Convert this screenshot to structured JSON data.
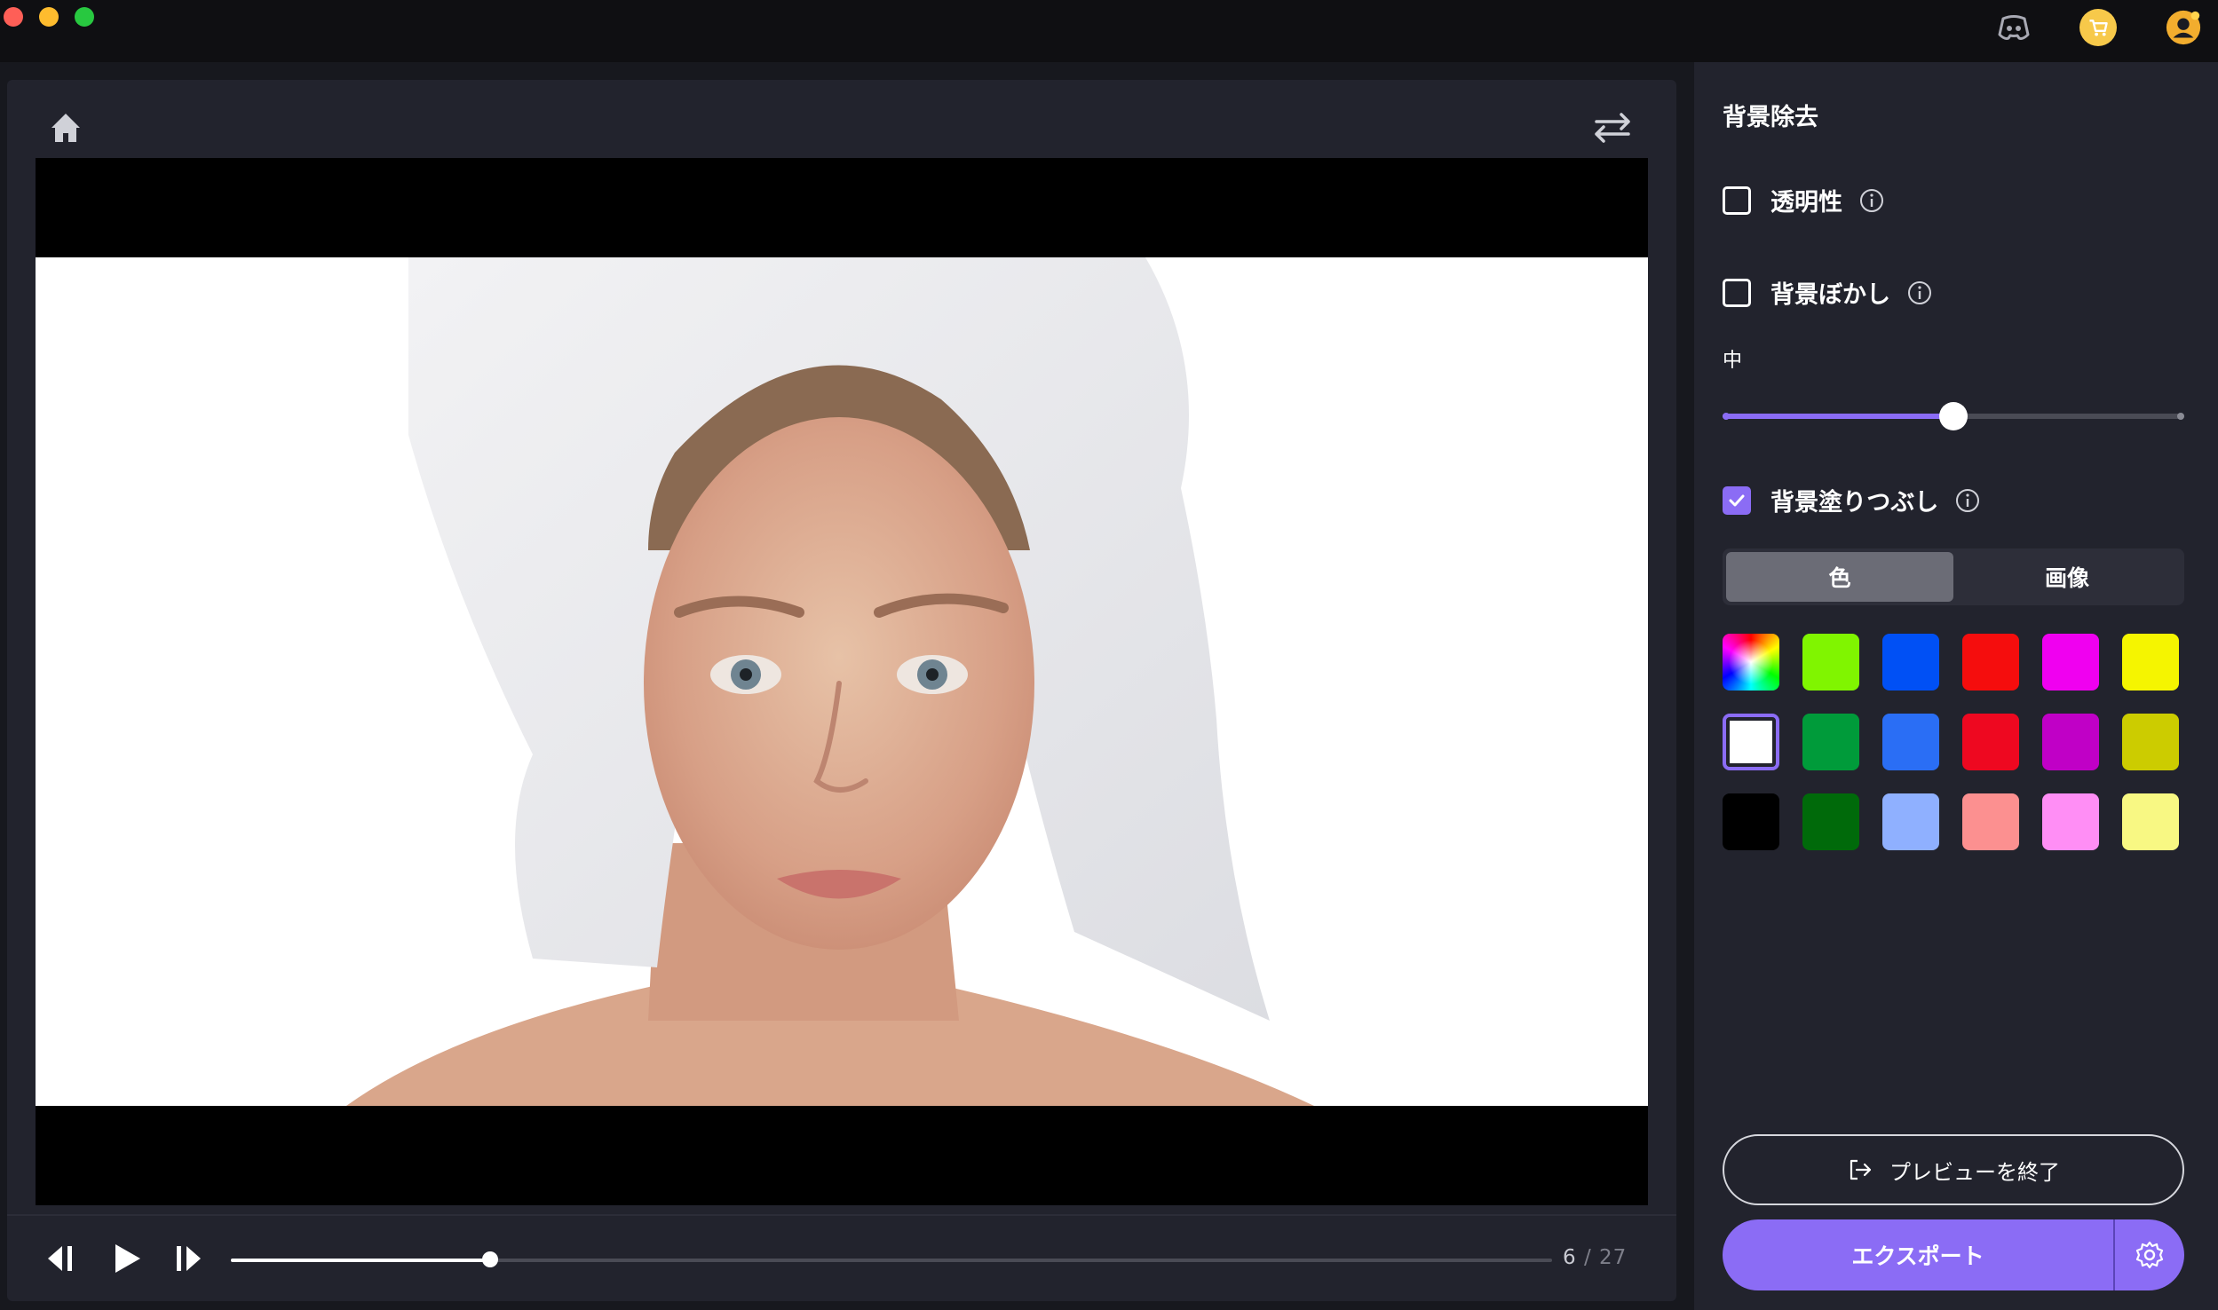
{
  "panel": {
    "title": "背景除去",
    "transparency_label": "透明性",
    "blur_label": "背景ぼかし",
    "blur_level_label": "中",
    "blur_level_value": 0.5,
    "fill_label": "背景塗りつぶし",
    "fill_checked": true,
    "tabs": {
      "color": "色",
      "image": "画像"
    },
    "active_tab": "色",
    "swatches": [
      "rainbow",
      "#80f500",
      "#0050f5",
      "#f50d0d",
      "#f000f0",
      "#f5f500",
      "#ffffff",
      "#009b3a",
      "#2a6ef5",
      "#ee0820",
      "#c000c6",
      "#cccc00",
      "#000000",
      "#006a0a",
      "#8fb0ff",
      "#fc9090",
      "#ff8ef5",
      "#f8f883"
    ],
    "selected_swatch": "#ffffff",
    "end_preview_label": "プレビューを終了",
    "export_label": "エクスポート"
  },
  "player": {
    "current_frame": "6",
    "separator": "/",
    "total_frames": "27",
    "progress": 0.196
  },
  "colors": {
    "accent": "#8b6cf5",
    "panel_bg": "#22232d",
    "app_bg": "#17181e"
  }
}
